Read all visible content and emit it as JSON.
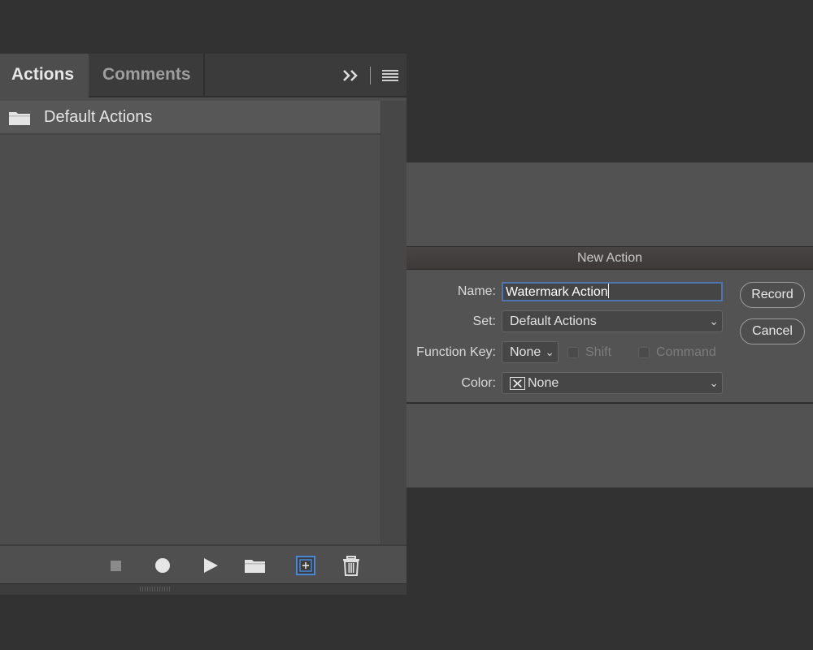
{
  "actions_panel": {
    "tabs": [
      {
        "label": "Actions",
        "active": true
      },
      {
        "label": "Comments",
        "active": false
      }
    ],
    "header_icons": [
      "expand-double-chevron-icon",
      "panel-menu-icon"
    ],
    "sets": [
      {
        "label": "Default Actions",
        "icon": "folder-icon"
      }
    ],
    "bottom_toolbar": [
      "stop-icon",
      "record-icon",
      "play-icon",
      "new-set-folder-icon",
      "new-action-icon",
      "trash-icon"
    ]
  },
  "new_action_dialog": {
    "title": "New Action",
    "name_label": "Name:",
    "name_value": "Watermark Action",
    "set_label": "Set:",
    "set_value": "Default Actions",
    "function_key_label": "Function Key:",
    "function_key_value": "None",
    "shift_label": "Shift",
    "command_label": "Command",
    "color_label": "Color:",
    "color_value": "None",
    "record_button": "Record",
    "cancel_button": "Cancel"
  },
  "colors": {
    "background": "#323232",
    "panel": "#4d4d4d",
    "focus_border": "#4f74b0",
    "new_action_highlight": "#4a86d6"
  }
}
